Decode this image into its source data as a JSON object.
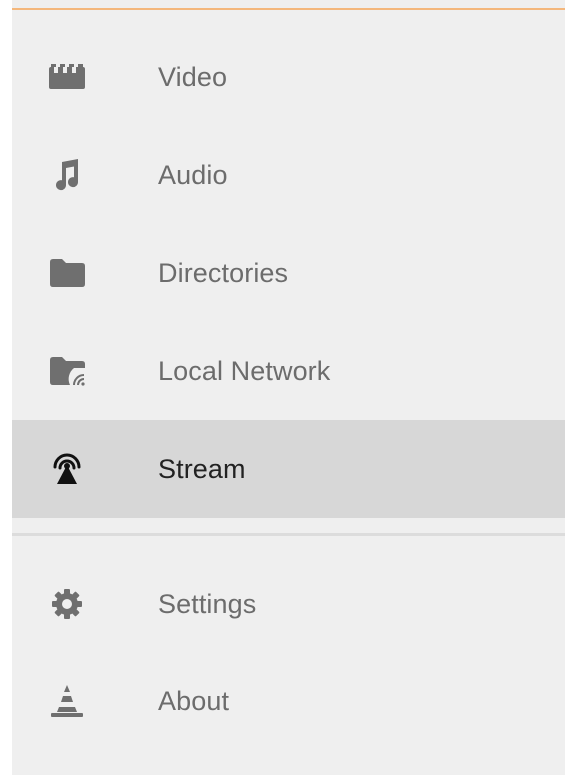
{
  "drawer": {
    "accent_color": "#f4b77c",
    "active_background": "#d7d7d7",
    "items": [
      {
        "label": "Video",
        "icon": "video-clapper-icon",
        "active": false
      },
      {
        "label": "Audio",
        "icon": "music-note-icon",
        "active": false
      },
      {
        "label": "Directories",
        "icon": "folder-icon",
        "active": false
      },
      {
        "label": "Local Network",
        "icon": "network-folder-icon",
        "active": false
      },
      {
        "label": "Stream",
        "icon": "stream-antenna-icon",
        "active": true
      }
    ],
    "secondary_items": [
      {
        "label": "Settings",
        "icon": "gear-icon"
      },
      {
        "label": "About",
        "icon": "vlc-cone-icon"
      }
    ]
  }
}
